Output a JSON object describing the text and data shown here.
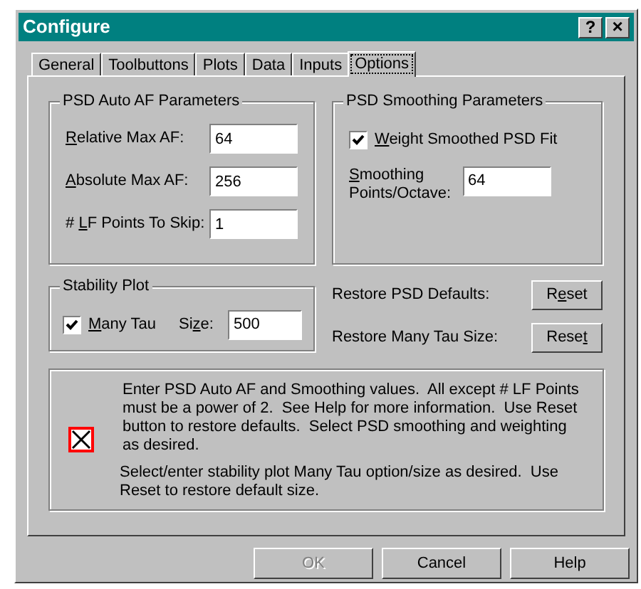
{
  "window": {
    "title": "Configure",
    "help_button": "?",
    "close_button": "×"
  },
  "tabs": [
    {
      "label": "General",
      "selected": false
    },
    {
      "label": "Toolbuttons",
      "selected": false
    },
    {
      "label": "Plots",
      "selected": false
    },
    {
      "label": "Data",
      "selected": false
    },
    {
      "label": "Inputs",
      "selected": false
    },
    {
      "label": "Options",
      "selected": true
    }
  ],
  "psd_auto_af": {
    "title": "PSD Auto AF Parameters",
    "fields": [
      {
        "key": "R",
        "post": "elative Max AF:",
        "value": "64"
      },
      {
        "key": "A",
        "post": "bsolute Max AF:",
        "value": "256"
      },
      {
        "pre": "# ",
        "key": "L",
        "post": "F Points To Skip:",
        "value": "1"
      }
    ]
  },
  "psd_smoothing": {
    "title": "PSD Smoothing Parameters",
    "checkbox": {
      "key": "W",
      "post": "eight Smoothed PSD Fit",
      "checked": true
    },
    "field": {
      "key": "S",
      "post": "moothing",
      "line2": "Points/Octave:",
      "value": "64"
    }
  },
  "stability_plot": {
    "title": "Stability Plot",
    "checkbox": {
      "key": "M",
      "post": "any Tau",
      "checked": true
    },
    "size_label": {
      "pre": "Si",
      "key": "z",
      "post": "e:"
    },
    "value": "500"
  },
  "restore": [
    {
      "label": "Restore PSD Defaults:",
      "button": {
        "pre": "R",
        "key": "e",
        "post": "set"
      }
    },
    {
      "label": "Restore Many Tau Size:",
      "button": {
        "pre": "Rese",
        "key": "t"
      }
    }
  ],
  "info": {
    "paragraphs": [
      "Enter PSD Auto AF and Smoothing values.  All except # LF Points must be a power of 2.  See Help for more information.  Use Reset button to restore defaults.  Select PSD smoothing and weighting as desired.",
      "Select/enter stability plot Many Tau option/size as desired.  Use Reset to restore default size."
    ]
  },
  "buttons": [
    {
      "label": "OK",
      "disabled": true
    },
    {
      "label": "Cancel",
      "disabled": false
    },
    {
      "label": "Help",
      "disabled": false
    }
  ]
}
